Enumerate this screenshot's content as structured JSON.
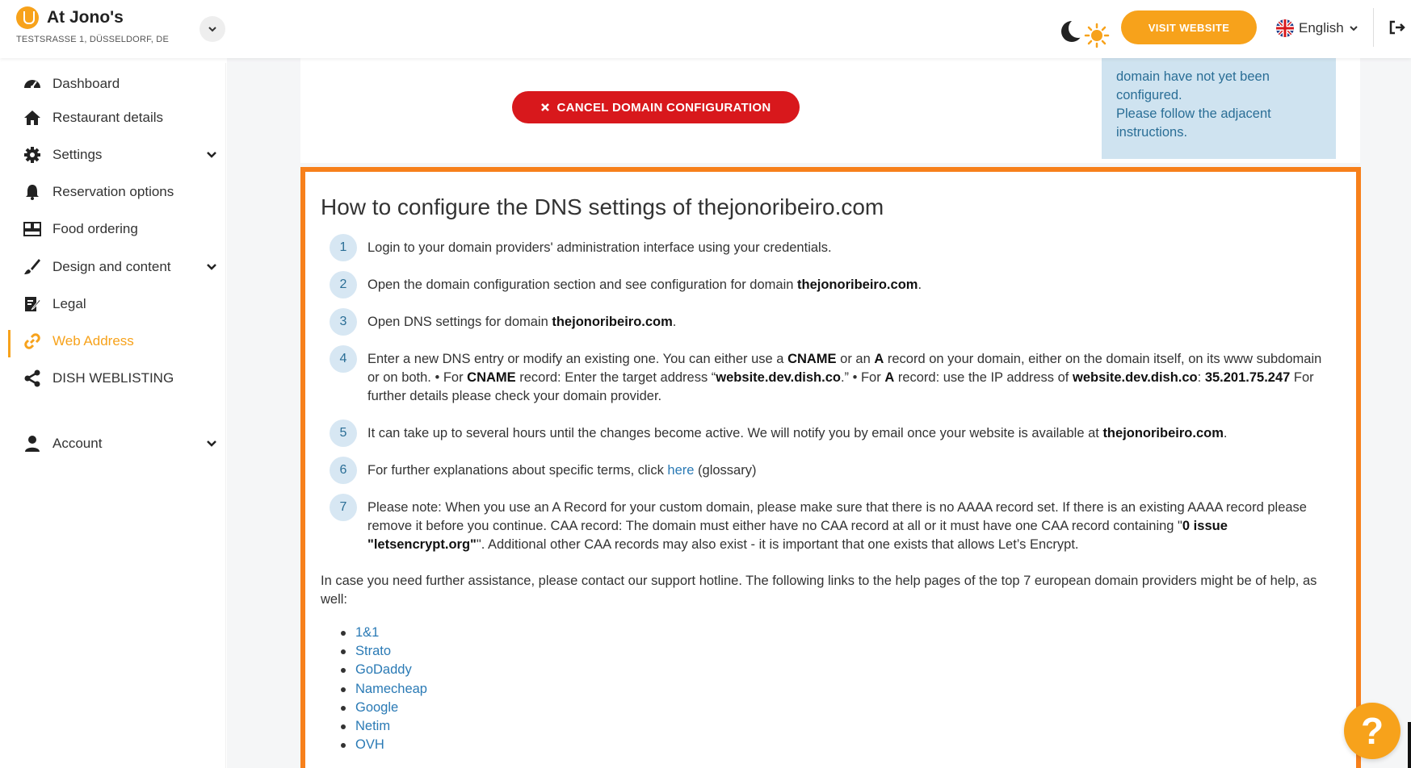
{
  "header": {
    "restaurant_name": "At Jono's",
    "address": "TESTSRASSE 1, DÜSSELDORF, DE",
    "visit_website": "VISIT WEBSITE",
    "language": "English"
  },
  "sidebar": {
    "items": [
      {
        "label": "Dashboard",
        "icon": "dashboard-icon"
      },
      {
        "label": "Restaurant details",
        "icon": "home-icon"
      },
      {
        "label": "Settings",
        "icon": "gear-icon",
        "expandable": true
      },
      {
        "label": "Reservation options",
        "icon": "bell-icon"
      },
      {
        "label": "Food ordering",
        "icon": "food-ordering-icon"
      },
      {
        "label": "Design and content",
        "icon": "brush-icon",
        "expandable": true
      },
      {
        "label": "Legal",
        "icon": "legal-icon"
      },
      {
        "label": "Web Address",
        "icon": "link-icon",
        "active": true
      },
      {
        "label": "DISH WEBLISTING",
        "icon": "share-icon"
      },
      {
        "label": "Account",
        "icon": "user-icon",
        "expandable": true
      }
    ]
  },
  "main": {
    "cancel_button": "CANCEL DOMAIN CONFIGURATION",
    "info_box": {
      "lines": [
        "domain have not yet been",
        "configured.",
        "Please follow the adjacent",
        "instructions."
      ]
    },
    "dns": {
      "title": "How to configure the DNS settings of thejonoribeiro.com",
      "domain": "thejonoribeiro.com",
      "steps": [
        {
          "num": "1",
          "text": "Login to your domain providers' administration interface using your credentials."
        },
        {
          "num": "2",
          "text_before": "Open the domain configuration section and see configuration for domain ",
          "bold": "thejonoribeiro.com",
          "text_after": "."
        },
        {
          "num": "3",
          "text_before": "Open DNS settings for domain ",
          "bold": "thejonoribeiro.com",
          "text_after": "."
        },
        {
          "num": "4",
          "p1": "Enter a new DNS entry or modify an existing one. You can either use a ",
          "b1": "CNAME",
          "p2": " or an ",
          "b2": "A",
          "p3": " record on your domain, either on the domain itself, on its www subdomain or on both. • For ",
          "b3": "CNAME",
          "p4": " record: Enter the target address “",
          "b4": "website.dev.dish.co",
          "p5": ".” • For ",
          "b5": "A",
          "p6": " record: use the IP address of ",
          "b6": "website.dev.dish.co",
          "p7": ": ",
          "b7": "35.201.75.247",
          "p8": " For further details please check your domain provider."
        },
        {
          "num": "5",
          "text_before": "It can take up to several hours until the changes become active. We will notify you by email once your website is available at ",
          "bold": "thejonoribeiro.com",
          "text_after": "."
        },
        {
          "num": "6",
          "text_before": "For further explanations about specific terms, click ",
          "link": "here",
          "text_after": " (glossary)"
        },
        {
          "num": "7",
          "text_before": "Please note: When you use an A Record for your custom domain, please make sure that there is no AAAA record set. If there is an existing AAAA record please remove it before you continue. CAA record: The domain must either have no CAA record at all or it must have one CAA record containing \"",
          "bold": "0 issue \"letsencrypt.org\"",
          "text_after": "\". Additional other CAA records may also exist - it is important that one exists that allows Let’s Encrypt."
        }
      ],
      "assistance": "In case you need further assistance, please contact our support hotline. The following links to the help pages of the top 7 european domain providers might be of help, as well:",
      "providers": [
        "1&1",
        "Strato",
        "GoDaddy",
        "Namecheap",
        "Google",
        "Netim",
        "OVH"
      ]
    }
  },
  "help_button": "?",
  "colors": {
    "accent": "#f7a21b",
    "danger": "#d8181c",
    "highlight_border": "#f7801b",
    "info_bg": "#cfe3f0",
    "link": "#2a7ab5"
  }
}
